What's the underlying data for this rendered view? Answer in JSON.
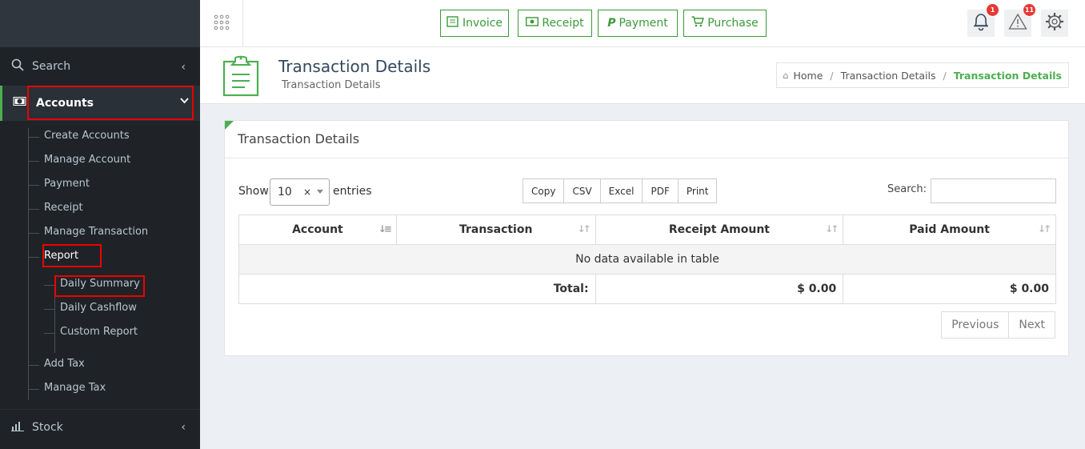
{
  "sidebar": {
    "search_label": "Search",
    "accounts_label": "Accounts",
    "sub_items": [
      "Create Accounts",
      "Manage Account",
      "Payment",
      "Receipt",
      "Manage Transaction",
      "Report"
    ],
    "report_items": [
      "Daily Summary",
      "Daily Cashflow",
      "Custom Report"
    ],
    "tail_items": [
      "Add Tax",
      "Manage Tax"
    ],
    "stock_label": "Stock"
  },
  "topbar": {
    "quick_buttons": [
      "Invoice",
      "Receipt",
      "Payment",
      "Purchase"
    ],
    "notifications_count": "1",
    "alerts_count": "11"
  },
  "header": {
    "title": "Transaction Details",
    "subtitle": "Transaction Details",
    "breadcrumb": [
      "Home",
      "Transaction Details",
      "Transaction Details"
    ]
  },
  "box": {
    "title": "Transaction Details",
    "show_label": "Show",
    "page_length": "10",
    "entries_label": "entries",
    "export_buttons": [
      "Copy",
      "CSV",
      "Excel",
      "PDF",
      "Print"
    ],
    "search_label": "Search:",
    "search_value": "",
    "columns": [
      "Account",
      "Transaction",
      "Receipt Amount",
      "Paid Amount"
    ],
    "empty_message": "No data available in table",
    "total_label": "Total:",
    "total_receipt": "$ 0.00",
    "total_paid": "$ 0.00",
    "pager": [
      "Previous",
      "Next"
    ]
  },
  "colors": {
    "accent": "#4caf50",
    "sidebar": "#1f2327",
    "badge": "#e53935",
    "highlight": "#e00000"
  }
}
